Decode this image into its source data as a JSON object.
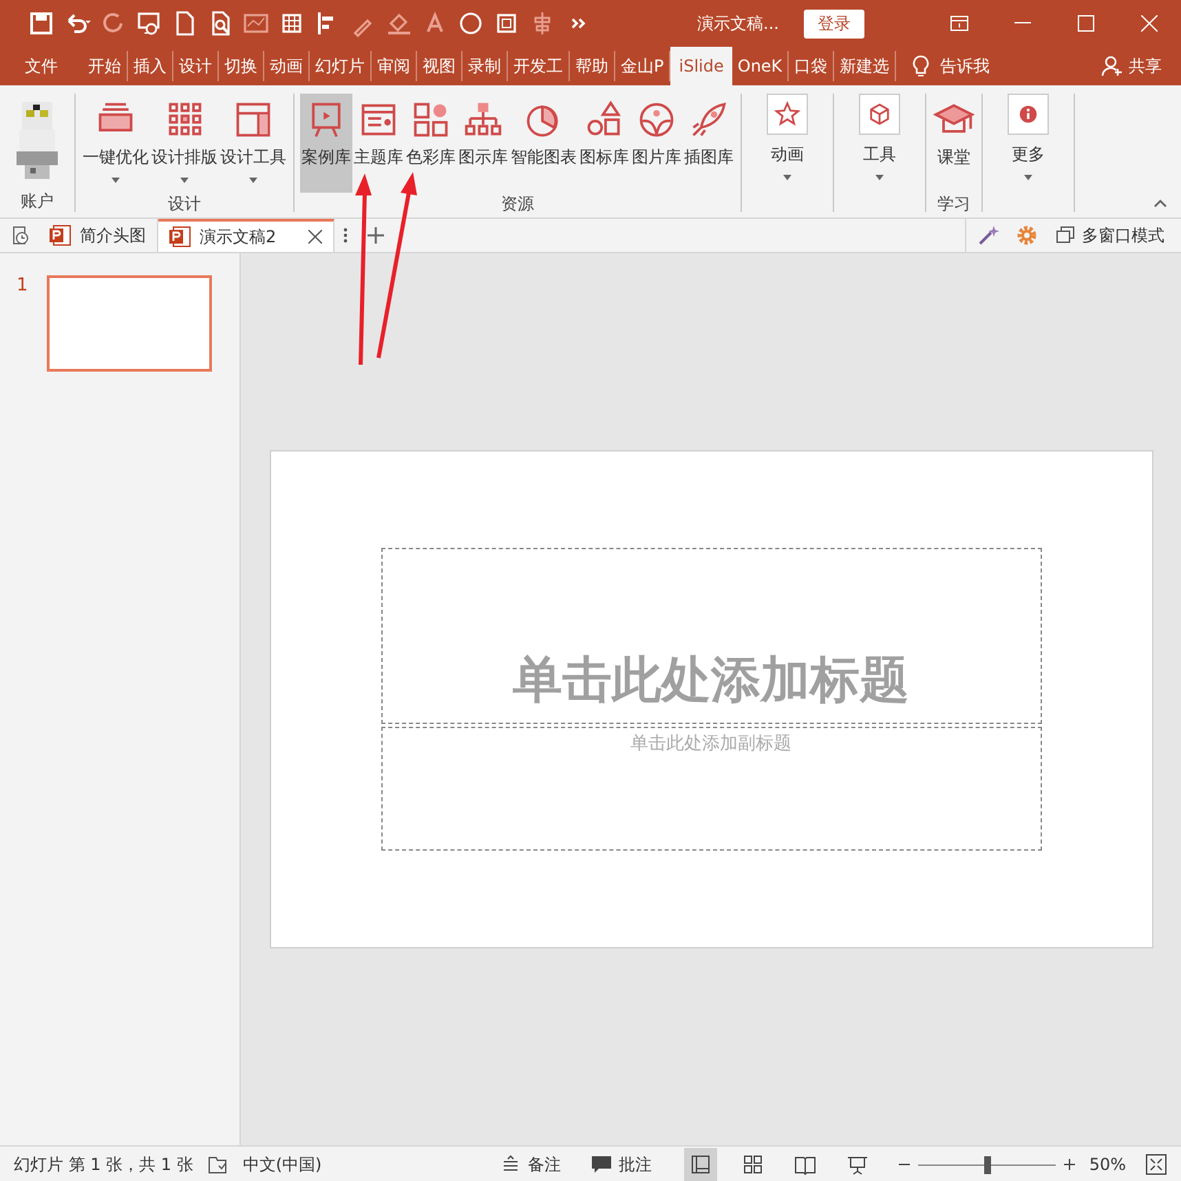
{
  "title_bar": {
    "title": "演示文稿...",
    "login_button": "登录"
  },
  "ribbon_tabs": [
    {
      "label": "文件",
      "selected": false
    },
    {
      "label": "开始",
      "selected": false
    },
    {
      "label": "插入",
      "selected": false
    },
    {
      "label": "设计",
      "selected": false
    },
    {
      "label": "切换",
      "selected": false
    },
    {
      "label": "动画",
      "selected": false
    },
    {
      "label": "幻灯片",
      "selected": false
    },
    {
      "label": "审阅",
      "selected": false
    },
    {
      "label": "视图",
      "selected": false
    },
    {
      "label": "录制",
      "selected": false
    },
    {
      "label": "开发工",
      "selected": false
    },
    {
      "label": "帮助",
      "selected": false
    },
    {
      "label": "金山P",
      "selected": false
    },
    {
      "label": "iSlide",
      "selected": true
    },
    {
      "label": "OneK",
      "selected": false
    },
    {
      "label": "口袋",
      "selected": false
    },
    {
      "label": "新建选",
      "selected": false
    }
  ],
  "tell_me": "告诉我",
  "share": "共享",
  "ribbon_groups": [
    {
      "label": "账户",
      "kind": "account"
    },
    {
      "label": "设计",
      "kind": "buttons",
      "buttons": [
        {
          "label": "一键优化",
          "dropdown": true,
          "selected": false
        },
        {
          "label": "设计排版",
          "dropdown": true,
          "selected": false
        },
        {
          "label": "设计工具",
          "dropdown": true,
          "selected": false
        }
      ]
    },
    {
      "label": "资源",
      "kind": "buttons",
      "buttons": [
        {
          "label": "案例库",
          "dropdown": false,
          "selected": true
        },
        {
          "label": "主题库",
          "dropdown": false,
          "selected": false
        },
        {
          "label": "色彩库",
          "dropdown": false,
          "selected": false
        },
        {
          "label": "图示库",
          "dropdown": false,
          "selected": false
        },
        {
          "label": "智能图表",
          "dropdown": false,
          "selected": false
        },
        {
          "label": "图标库",
          "dropdown": false,
          "selected": false
        },
        {
          "label": "图片库",
          "dropdown": false,
          "selected": false
        },
        {
          "label": "插图库",
          "dropdown": false,
          "selected": false
        }
      ]
    },
    {
      "kind": "boxed",
      "buttons": [
        {
          "label": "动画",
          "dropdown": true,
          "selected": false
        }
      ]
    },
    {
      "kind": "boxed",
      "buttons": [
        {
          "label": "工具",
          "dropdown": true,
          "selected": false
        }
      ]
    },
    {
      "label": "学习",
      "kind": "buttons",
      "buttons": [
        {
          "label": "课堂",
          "dropdown": false,
          "selected": false
        }
      ]
    },
    {
      "kind": "boxed",
      "buttons": [
        {
          "label": "更多",
          "dropdown": true,
          "selected": false
        }
      ]
    }
  ],
  "document_tabs": [
    {
      "label": "简介头图",
      "selected": false
    },
    {
      "label": "演示文稿2",
      "selected": true
    }
  ],
  "multi_window": "多窗口模式",
  "thumbnails": [
    {
      "number": "1",
      "selected": true
    }
  ],
  "slide": {
    "title_placeholder": "单击此处添加标题",
    "subtitle_placeholder": "单击此处添加副标题"
  },
  "status_bar": {
    "slide_info": "幻灯片 第 1 张，共 1 张",
    "language": "中文(中国)",
    "notes": "备注",
    "comments": "批注",
    "zoom": {
      "level": 0.5,
      "reading": "50%"
    }
  }
}
